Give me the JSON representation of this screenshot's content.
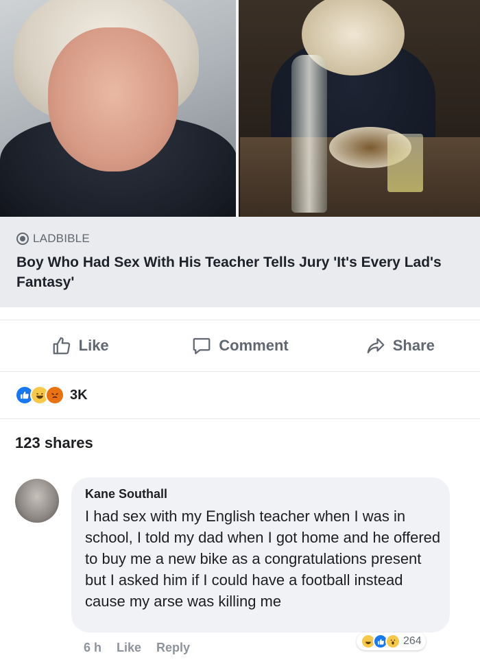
{
  "post": {
    "source": "LADBIBLE",
    "headline": "Boy Who Had Sex With His Teacher Tells Jury 'It's Every Lad's Fantasy'"
  },
  "actions": {
    "like": "Like",
    "comment": "Comment",
    "share": "Share"
  },
  "reactions": {
    "icons": [
      "like-icon",
      "haha-icon",
      "angry-icon"
    ],
    "count": "3K"
  },
  "shares": "123 shares",
  "comment": {
    "author": "Kane Southall",
    "text": "I had sex with my English teacher when I was in school, I told my dad when I got home and he offered to buy me a new bike as a congratulations present but I asked him if I could have a football instead cause my arse was killing me",
    "time": "6 h",
    "like": "Like",
    "reply": "Reply",
    "reaction_icons": [
      "haha-icon",
      "like-icon",
      "wow-icon"
    ],
    "reaction_count": "264"
  },
  "colors": {
    "fb_blue": "#1877f2",
    "card_bg": "#e9ebee",
    "muted_text": "#606770"
  }
}
